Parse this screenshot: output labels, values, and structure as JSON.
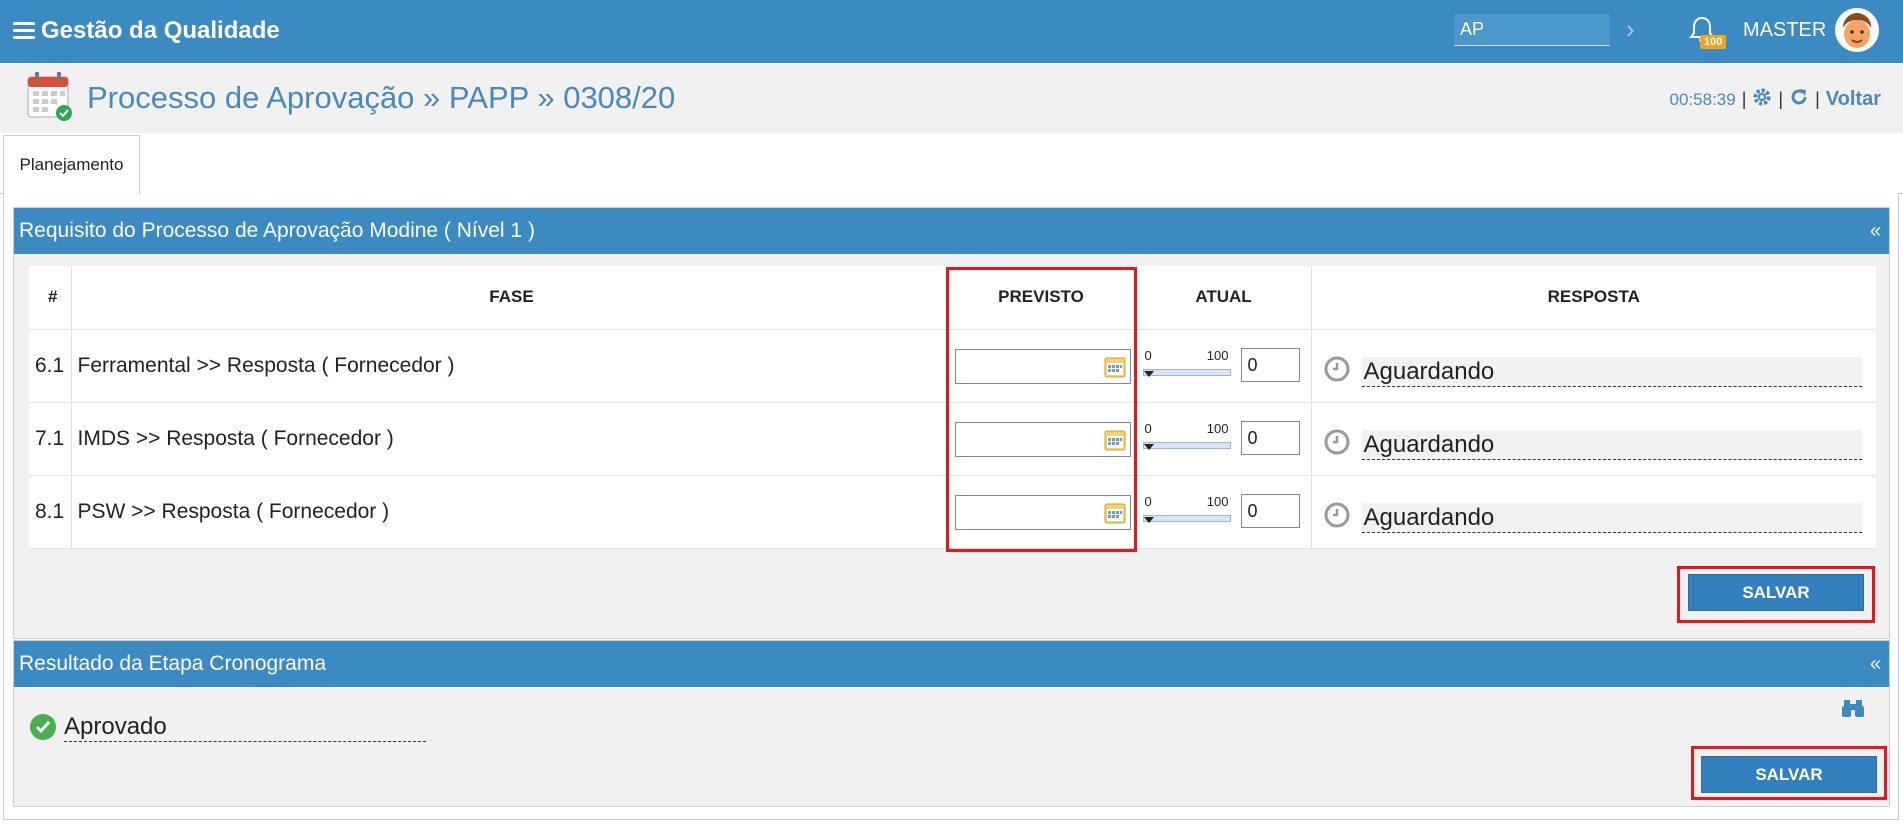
{
  "topbar": {
    "title": "Gestão da Qualidade",
    "search_value": "AP",
    "notification_count": "100",
    "user": "MASTER"
  },
  "header": {
    "title": "Processo de Aprovação » PAPP » 0308/20",
    "timer": "00:58:39",
    "back_label": "Voltar"
  },
  "tabs": [
    {
      "label": "Planejamento"
    }
  ],
  "requirements_panel": {
    "title": "Requisito do Processo de Aprovação Modine ( Nível 1 )",
    "collapse": "«",
    "columns": {
      "num": "#",
      "phase": "FASE",
      "planned": "PREVISTO",
      "current": "ATUAL",
      "response": "RESPOSTA"
    },
    "rows": [
      {
        "num": "6.1",
        "phase": "Ferramental >> Resposta ( Fornecedor )",
        "planned": "",
        "slider_min": "0",
        "slider_max": "100",
        "current": "0",
        "response": "Aguardando"
      },
      {
        "num": "7.1",
        "phase": "IMDS >> Resposta ( Fornecedor )",
        "planned": "",
        "slider_min": "0",
        "slider_max": "100",
        "current": "0",
        "response": "Aguardando"
      },
      {
        "num": "8.1",
        "phase": "PSW >> Resposta ( Fornecedor )",
        "planned": "",
        "slider_min": "0",
        "slider_max": "100",
        "current": "0",
        "response": "Aguardando"
      }
    ],
    "save_label": "SALVAR"
  },
  "result_panel": {
    "title": "Resultado da Etapa Cronograma",
    "collapse": "«",
    "result": "Aprovado",
    "save_label": "SALVAR"
  },
  "colors": {
    "primary": "#3b8bc2",
    "button": "#3480bd",
    "highlight": "#e8151b",
    "title_text": "#4a89bf",
    "badge": "#f2a51c",
    "success": "#4cae4c"
  }
}
